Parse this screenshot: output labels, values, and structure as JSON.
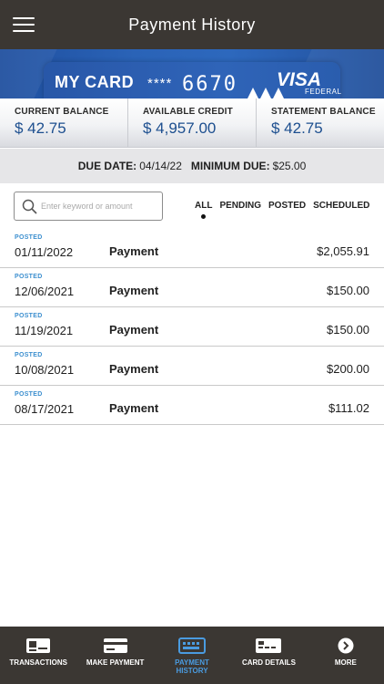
{
  "header": {
    "title": "Payment History",
    "menu_icon": "hamburger-menu-icon"
  },
  "card": {
    "name": "MY CARD",
    "mask": "****",
    "last4": "6670",
    "brand": "VISA",
    "brand_sub": "FEDERAL"
  },
  "balances": [
    {
      "label": "CURRENT BALANCE",
      "value": "$ 42.75"
    },
    {
      "label": "AVAILABLE CREDIT",
      "value": "$ 4,957.00"
    },
    {
      "label": "STATEMENT BALANCE",
      "value": "$ 42.75"
    }
  ],
  "due": {
    "date_label": "DUE DATE:",
    "date": "04/14/22",
    "min_label": "MINIMUM DUE:",
    "min": "$25.00"
  },
  "search": {
    "placeholder": "Enter keyword or amount"
  },
  "filters": [
    "ALL",
    "PENDING",
    "POSTED",
    "SCHEDULED"
  ],
  "active_filter": "ALL",
  "transactions": [
    {
      "status": "POSTED",
      "date": "01/11/2022",
      "type": "Payment",
      "amount": "$2,055.91"
    },
    {
      "status": "POSTED",
      "date": "12/06/2021",
      "type": "Payment",
      "amount": "$150.00"
    },
    {
      "status": "POSTED",
      "date": "11/19/2021",
      "type": "Payment",
      "amount": "$150.00"
    },
    {
      "status": "POSTED",
      "date": "10/08/2021",
      "type": "Payment",
      "amount": "$200.00"
    },
    {
      "status": "POSTED",
      "date": "08/17/2021",
      "type": "Payment",
      "amount": "$111.02"
    }
  ],
  "tabs": [
    {
      "label": "TRANSACTIONS",
      "icon": "transactions-icon"
    },
    {
      "label": "MAKE PAYMENT",
      "icon": "make-payment-icon"
    },
    {
      "label": "PAYMENT HISTORY",
      "icon": "payment-history-icon"
    },
    {
      "label": "CARD DETAILS",
      "icon": "card-details-icon"
    },
    {
      "label": "MORE",
      "icon": "more-icon"
    }
  ],
  "colors": {
    "header_bg": "#3b3733",
    "accent_blue": "#1d4f8f",
    "status_blue": "#3c8fcf",
    "active_tab": "#4a9be0"
  }
}
